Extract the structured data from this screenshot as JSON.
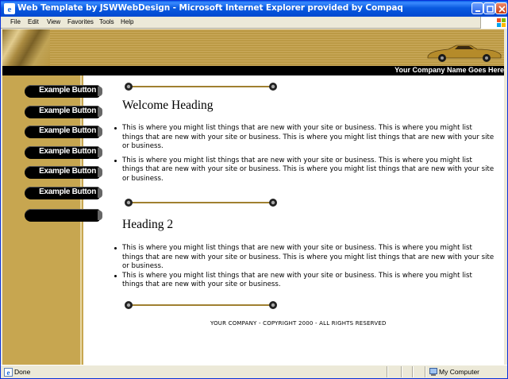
{
  "window": {
    "title": "Web Template by JSWWebDesign - Microsoft Internet Explorer provided by Compaq"
  },
  "menu": [
    {
      "accel": "F",
      "rest": "ile"
    },
    {
      "accel": "E",
      "rest": "dit"
    },
    {
      "accel": "V",
      "rest": "iew"
    },
    {
      "accel": "",
      "pre": "F",
      "rest": "avorites"
    },
    {
      "accel": "T",
      "rest": "ools"
    },
    {
      "accel": "H",
      "rest": "elp"
    }
  ],
  "menu_labels": {
    "file": "File",
    "edit": "Edit",
    "view": "View",
    "favorites": "Favorites",
    "tools": "Tools",
    "help": "Help"
  },
  "banner": {
    "company_name": "Your Company Name Goes Here"
  },
  "sidebar": {
    "buttons": [
      {
        "label": "Example Button"
      },
      {
        "label": "Example Button"
      },
      {
        "label": "Example Button"
      },
      {
        "label": "Example Button"
      },
      {
        "label": "Example Button"
      },
      {
        "label": "Example Button"
      },
      {
        "label": ""
      }
    ]
  },
  "main": {
    "heading1": "Welcome Heading",
    "section1_items": [
      "This is where you might list things that are new with your site or business. This is where you might list things that are new with your site or business. This is where you might list things that are new with your site or business.",
      "This is where you might list things that are new with your site or business. This is where you might list things that are new with your site or business. This is where you might list things that are new with your site or business."
    ],
    "heading2": "Heading 2",
    "section2_items": [
      "This is where you might list things that are new with your site or business. This is where you might list things that are new with your site or business. This is where you might list things that are new with your site or business.",
      "This is where you might list things that are new with your site or business. This is where you might list things that are new with your site or business."
    ],
    "footer": "YOUR COMPANY - COPYRIGHT 2000 - ALL RIGHTS RESERVED"
  },
  "status": {
    "left": "Done",
    "zone": "My Computer"
  },
  "colors": {
    "titlebar": "#0a5ae0",
    "gold": "#c7a650",
    "nav_button": "#000000"
  }
}
